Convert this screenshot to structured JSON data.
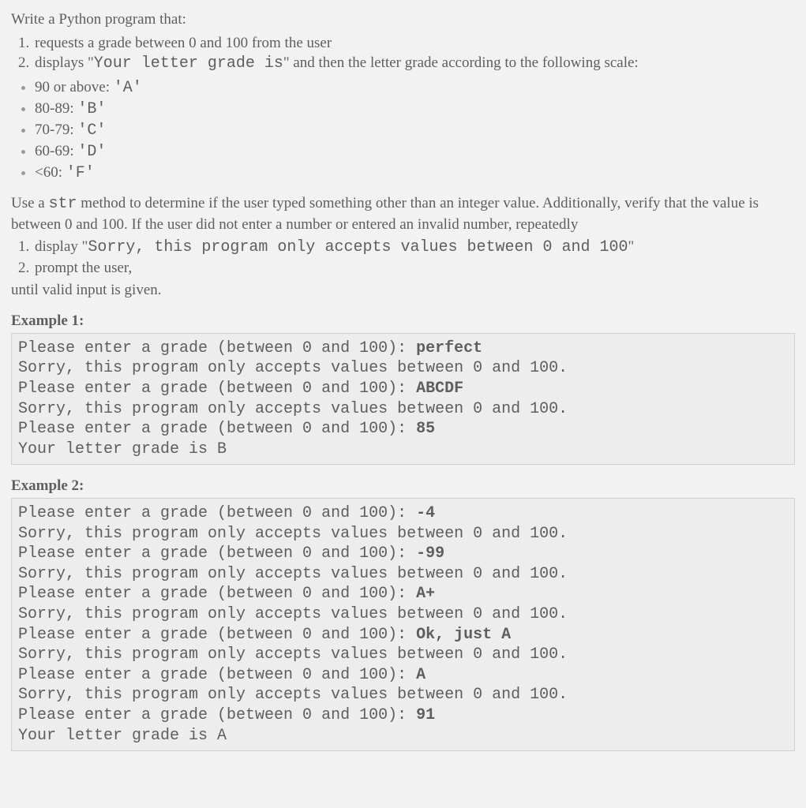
{
  "intro": "Write a Python program that:",
  "requirements": [
    {
      "pre": "requests a grade between 0 and 100 from the user",
      "code": "",
      "post": ""
    },
    {
      "pre": "displays \"",
      "code": "Your letter grade is",
      "post": "\" and then the letter grade according to the following scale:"
    }
  ],
  "scale": [
    {
      "label": "90 or above: ",
      "grade": "'A'"
    },
    {
      "label": "80-89: ",
      "grade": "'B'"
    },
    {
      "label": "70-79: ",
      "grade": "'C'"
    },
    {
      "label": "60-69: ",
      "grade": "'D'"
    },
    {
      "label": "<60: ",
      "grade": "'F'"
    }
  ],
  "paragraph": {
    "pre": "Use a ",
    "code": "str",
    "post": " method to determine if the user typed something other than an integer value.  Additionally, verify that the value is between 0 and 100.  If the user did not enter a number or entered an invalid number, repeatedly"
  },
  "error_steps": [
    {
      "pre": "display \"",
      "code": "Sorry, this program only accepts values between 0 and 100",
      "post": "\""
    },
    {
      "pre": "prompt the user,",
      "code": "",
      "post": ""
    }
  ],
  "until": "until valid input is given.",
  "example1": {
    "label": "Example 1:",
    "prompt": "Please enter a grade (between 0 and 100): ",
    "sorry": "Sorry, this program only accepts values between 0 and 100.",
    "inputs": [
      "perfect",
      "ABCDF",
      "85"
    ],
    "result": "Your letter grade is B"
  },
  "example2": {
    "label": "Example 2:",
    "prompt": "Please enter a grade (between 0 and 100): ",
    "sorry": "Sorry, this program only accepts values between 0 and 100.",
    "inputs": [
      "-4",
      "-99",
      "A+",
      "Ok, just A",
      "A",
      "91"
    ],
    "result": "Your letter grade is A"
  }
}
